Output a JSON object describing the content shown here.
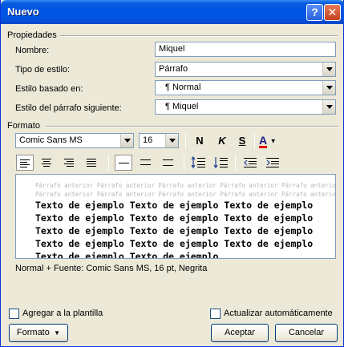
{
  "window": {
    "title": "Nuevo"
  },
  "titlebar": {
    "help_glyph": "?",
    "close_glyph": "✕"
  },
  "properties": {
    "heading": "Propiedades",
    "name_label": "Nombre:",
    "name_value": "Miquel",
    "style_type_label": "Tipo de estilo:",
    "style_type_value": "Párrafo",
    "based_on_label": "Estilo basado en:",
    "based_on_value": "¶ Normal",
    "next_style_label": "Estilo del párrafo siguiente:",
    "next_style_value": "¶ Miquel"
  },
  "format": {
    "heading": "Formato",
    "font_value": "Comic Sans MS",
    "size_value": "16",
    "bold_glyph": "N",
    "italic_glyph": "K",
    "underline_glyph": "S",
    "font_color_glyph": "A",
    "font_color_accent": "#e00000"
  },
  "preview": {
    "previous_paragraph": [
      "Párrafo anterior Párrafo anterior Párrafo anterior Párrafo anterior Párrafo anterior Párrafo anterior",
      "Párrafo anterior Párrafo anterior Párrafo anterior Párrafo anterior Párrafo anterior Párrafo anterior"
    ],
    "sample_lines": [
      "Texto de ejemplo Texto de ejemplo Texto de ejemplo",
      "Texto de ejemplo Texto de ejemplo Texto de ejemplo",
      "Texto de ejemplo Texto de ejemplo Texto de ejemplo",
      "Texto de ejemplo Texto de ejemplo Texto de ejemplo",
      "Texto de ejemplo Texto de ejemplo"
    ]
  },
  "description": "Normal + Fuente: Comic Sans MS, 16 pt, Negrita",
  "options": {
    "add_to_template_label": "Agregar a la plantilla",
    "auto_update_label": "Actualizar automáticamente"
  },
  "buttons": {
    "format_label": "Formato",
    "accept_label": "Aceptar",
    "cancel_label": "Cancelar"
  }
}
